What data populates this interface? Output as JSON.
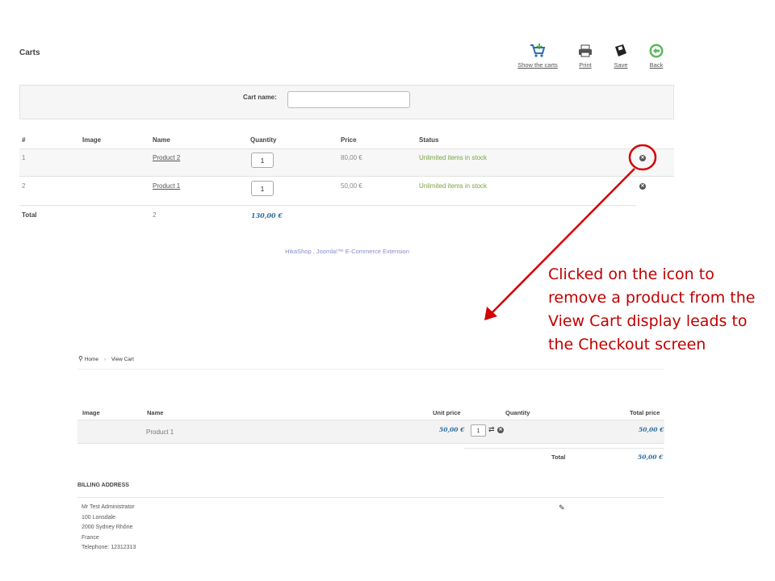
{
  "page": {
    "title": "Carts"
  },
  "toolbar": {
    "show_carts": "Show the carts",
    "print": "Print",
    "save": "Save",
    "back": "Back"
  },
  "filter": {
    "label": "Cart name:",
    "value": ""
  },
  "table": {
    "headers": [
      "#",
      "Image",
      "Name",
      "Quantity",
      "Price",
      "Status"
    ],
    "rows": [
      {
        "num": "1",
        "name": "Product 2",
        "qty": "1",
        "price": "80,00 €",
        "status": "Unlimited items in stock"
      },
      {
        "num": "2",
        "name": "Product 1",
        "qty": "1",
        "price": "50,00 €",
        "status": "Unlimited items in stock"
      }
    ],
    "total_label": "Total",
    "total_count": "2",
    "total_price": "130,00 €"
  },
  "footer": {
    "text": "HikaShop , Joomla!™ E-Commerce Extension"
  },
  "annotation": {
    "text": "Clicked on the icon to remove a product from the View Cart display leads to the Checkout screen"
  },
  "colors": {
    "annotation": "#c00000",
    "stock": "#7aa341",
    "price": "#2c6e9c"
  },
  "checkout": {
    "breadcrumb": {
      "home": "Home",
      "sep": "›",
      "current": "View Cart"
    },
    "headers": {
      "image": "Image",
      "name": "Name",
      "unit_price": "Unit price",
      "quantity": "Quantity",
      "total_price": "Total price"
    },
    "row": {
      "name": "Product 1",
      "unit_price": "50,00 €",
      "qty": "1",
      "total": "50,00 €"
    },
    "total_label": "Total",
    "total_value": "50,00 €",
    "billing": {
      "title": "BILLING ADDRESS",
      "lines": [
        "Mr Test Administrator",
        "100 Lonsdale",
        "2000 Sydney Rhône",
        "France",
        "Telephone: 12312313"
      ]
    }
  }
}
